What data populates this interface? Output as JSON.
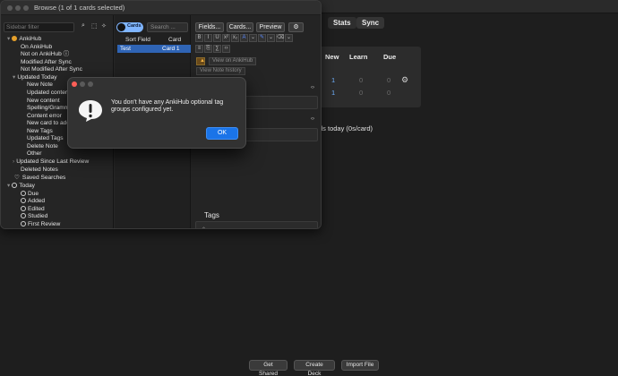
{
  "main": {
    "nav": {
      "stats": "Stats",
      "sync": "Sync"
    },
    "deck_headers": {
      "new": "New",
      "learn": "Learn",
      "due": "Due"
    },
    "deck_rows": [
      {
        "new": "1",
        "learn": "0",
        "due": "0"
      },
      {
        "new": "1",
        "learn": "0",
        "due": "0"
      }
    ],
    "studied_today": "ds today (0s/card)",
    "bottom_buttons": {
      "get_shared": "Get Shared",
      "create_deck": "Create Deck",
      "import_file": "Import File"
    },
    "accent_color": "#6fb2ff"
  },
  "browse": {
    "title": "Browse (1 of 1 cards selected)",
    "sidebar": {
      "filter_placeholder": "Sidebar filter",
      "items": [
        {
          "label": "AnkiHub",
          "arrow": "▾"
        },
        {
          "label": "On AnkiHub"
        },
        {
          "label": "Not on AnkiHub ⓘ"
        },
        {
          "label": "Modified After Sync"
        },
        {
          "label": "Not Modified After Sync"
        },
        {
          "label": "Updated Today",
          "arrow": "▾"
        },
        {
          "label": "New Note"
        },
        {
          "label": "Updated conter"
        },
        {
          "label": "New content"
        },
        {
          "label": "Spelling/Gramm"
        },
        {
          "label": "Content error"
        },
        {
          "label": "New card to add"
        },
        {
          "label": "New Tags"
        },
        {
          "label": "Updated Tags"
        },
        {
          "label": "Delete Note"
        },
        {
          "label": "Other"
        },
        {
          "label": "Updated Since Last Review",
          "arrow": "›"
        },
        {
          "label": "Deleted Notes"
        },
        {
          "label": "Saved Searches"
        },
        {
          "label": "Today",
          "arrow": "▾"
        },
        {
          "label": "Due"
        },
        {
          "label": "Added"
        },
        {
          "label": "Edited"
        },
        {
          "label": "Studied"
        },
        {
          "label": "First Review"
        }
      ]
    },
    "cards_toggle_label": "Cards",
    "search_placeholder": "Search ...",
    "columns": {
      "sort_field": "Sort Field",
      "card_type": "Card Typ"
    },
    "row": {
      "sort_field": "Test",
      "card_type": "Card 1"
    },
    "editor": {
      "fields_label": "Fields...",
      "cards_label": "Cards...",
      "preview_label": "Preview",
      "view_on_ankihub": "View on AnkiHub",
      "view_note_history": "View Note history",
      "tags_label": "Tags"
    }
  },
  "dialog": {
    "message": "You don't have any AnkiHub optional tag groups configured yet.",
    "ok_label": "OK"
  }
}
